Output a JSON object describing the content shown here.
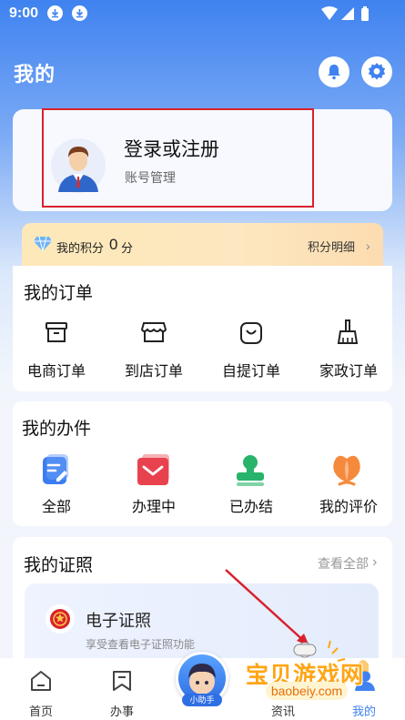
{
  "status": {
    "time": "9:00"
  },
  "header": {
    "title": "我的"
  },
  "profile": {
    "login_label": "登录或注册",
    "account_label": "账号管理"
  },
  "points": {
    "label": "我的积分",
    "value": "0",
    "unit": "分",
    "detail_label": "积分明细"
  },
  "orders": {
    "title": "我的订单",
    "items": [
      {
        "label": "电商订单",
        "icon": "archive-box-icon"
      },
      {
        "label": "到店订单",
        "icon": "storefront-icon"
      },
      {
        "label": "自提订单",
        "icon": "shopping-bag-icon"
      },
      {
        "label": "家政订单",
        "icon": "broom-icon"
      }
    ]
  },
  "affairs": {
    "title": "我的办件",
    "items": [
      {
        "label": "全部",
        "icon": "document-edit-icon"
      },
      {
        "label": "办理中",
        "icon": "envelope-icon"
      },
      {
        "label": "已办结",
        "icon": "stamp-icon"
      },
      {
        "label": "我的评价",
        "icon": "flower-icon"
      }
    ]
  },
  "certificates": {
    "title": "我的证照",
    "view_all_label": "查看全部",
    "card_title": "电子证照",
    "card_desc": "享受查看电子证照功能"
  },
  "bottom_nav": {
    "items": [
      {
        "label": "首页",
        "icon": "home-icon"
      },
      {
        "label": "办事",
        "icon": "bookmark-icon"
      },
      {
        "label": "资讯",
        "icon": "news-icon"
      },
      {
        "label": "我的",
        "icon": "user-icon"
      }
    ],
    "helper_label": "小助手"
  },
  "watermark": {
    "text": "宝贝游戏网",
    "url": "baobeiy.com"
  },
  "colors": {
    "primary": "#3f82f0",
    "highlight_border": "#d9212d",
    "accent_red": "#e8424f",
    "accent_green": "#27b36a",
    "accent_orange": "#f68a3c"
  }
}
